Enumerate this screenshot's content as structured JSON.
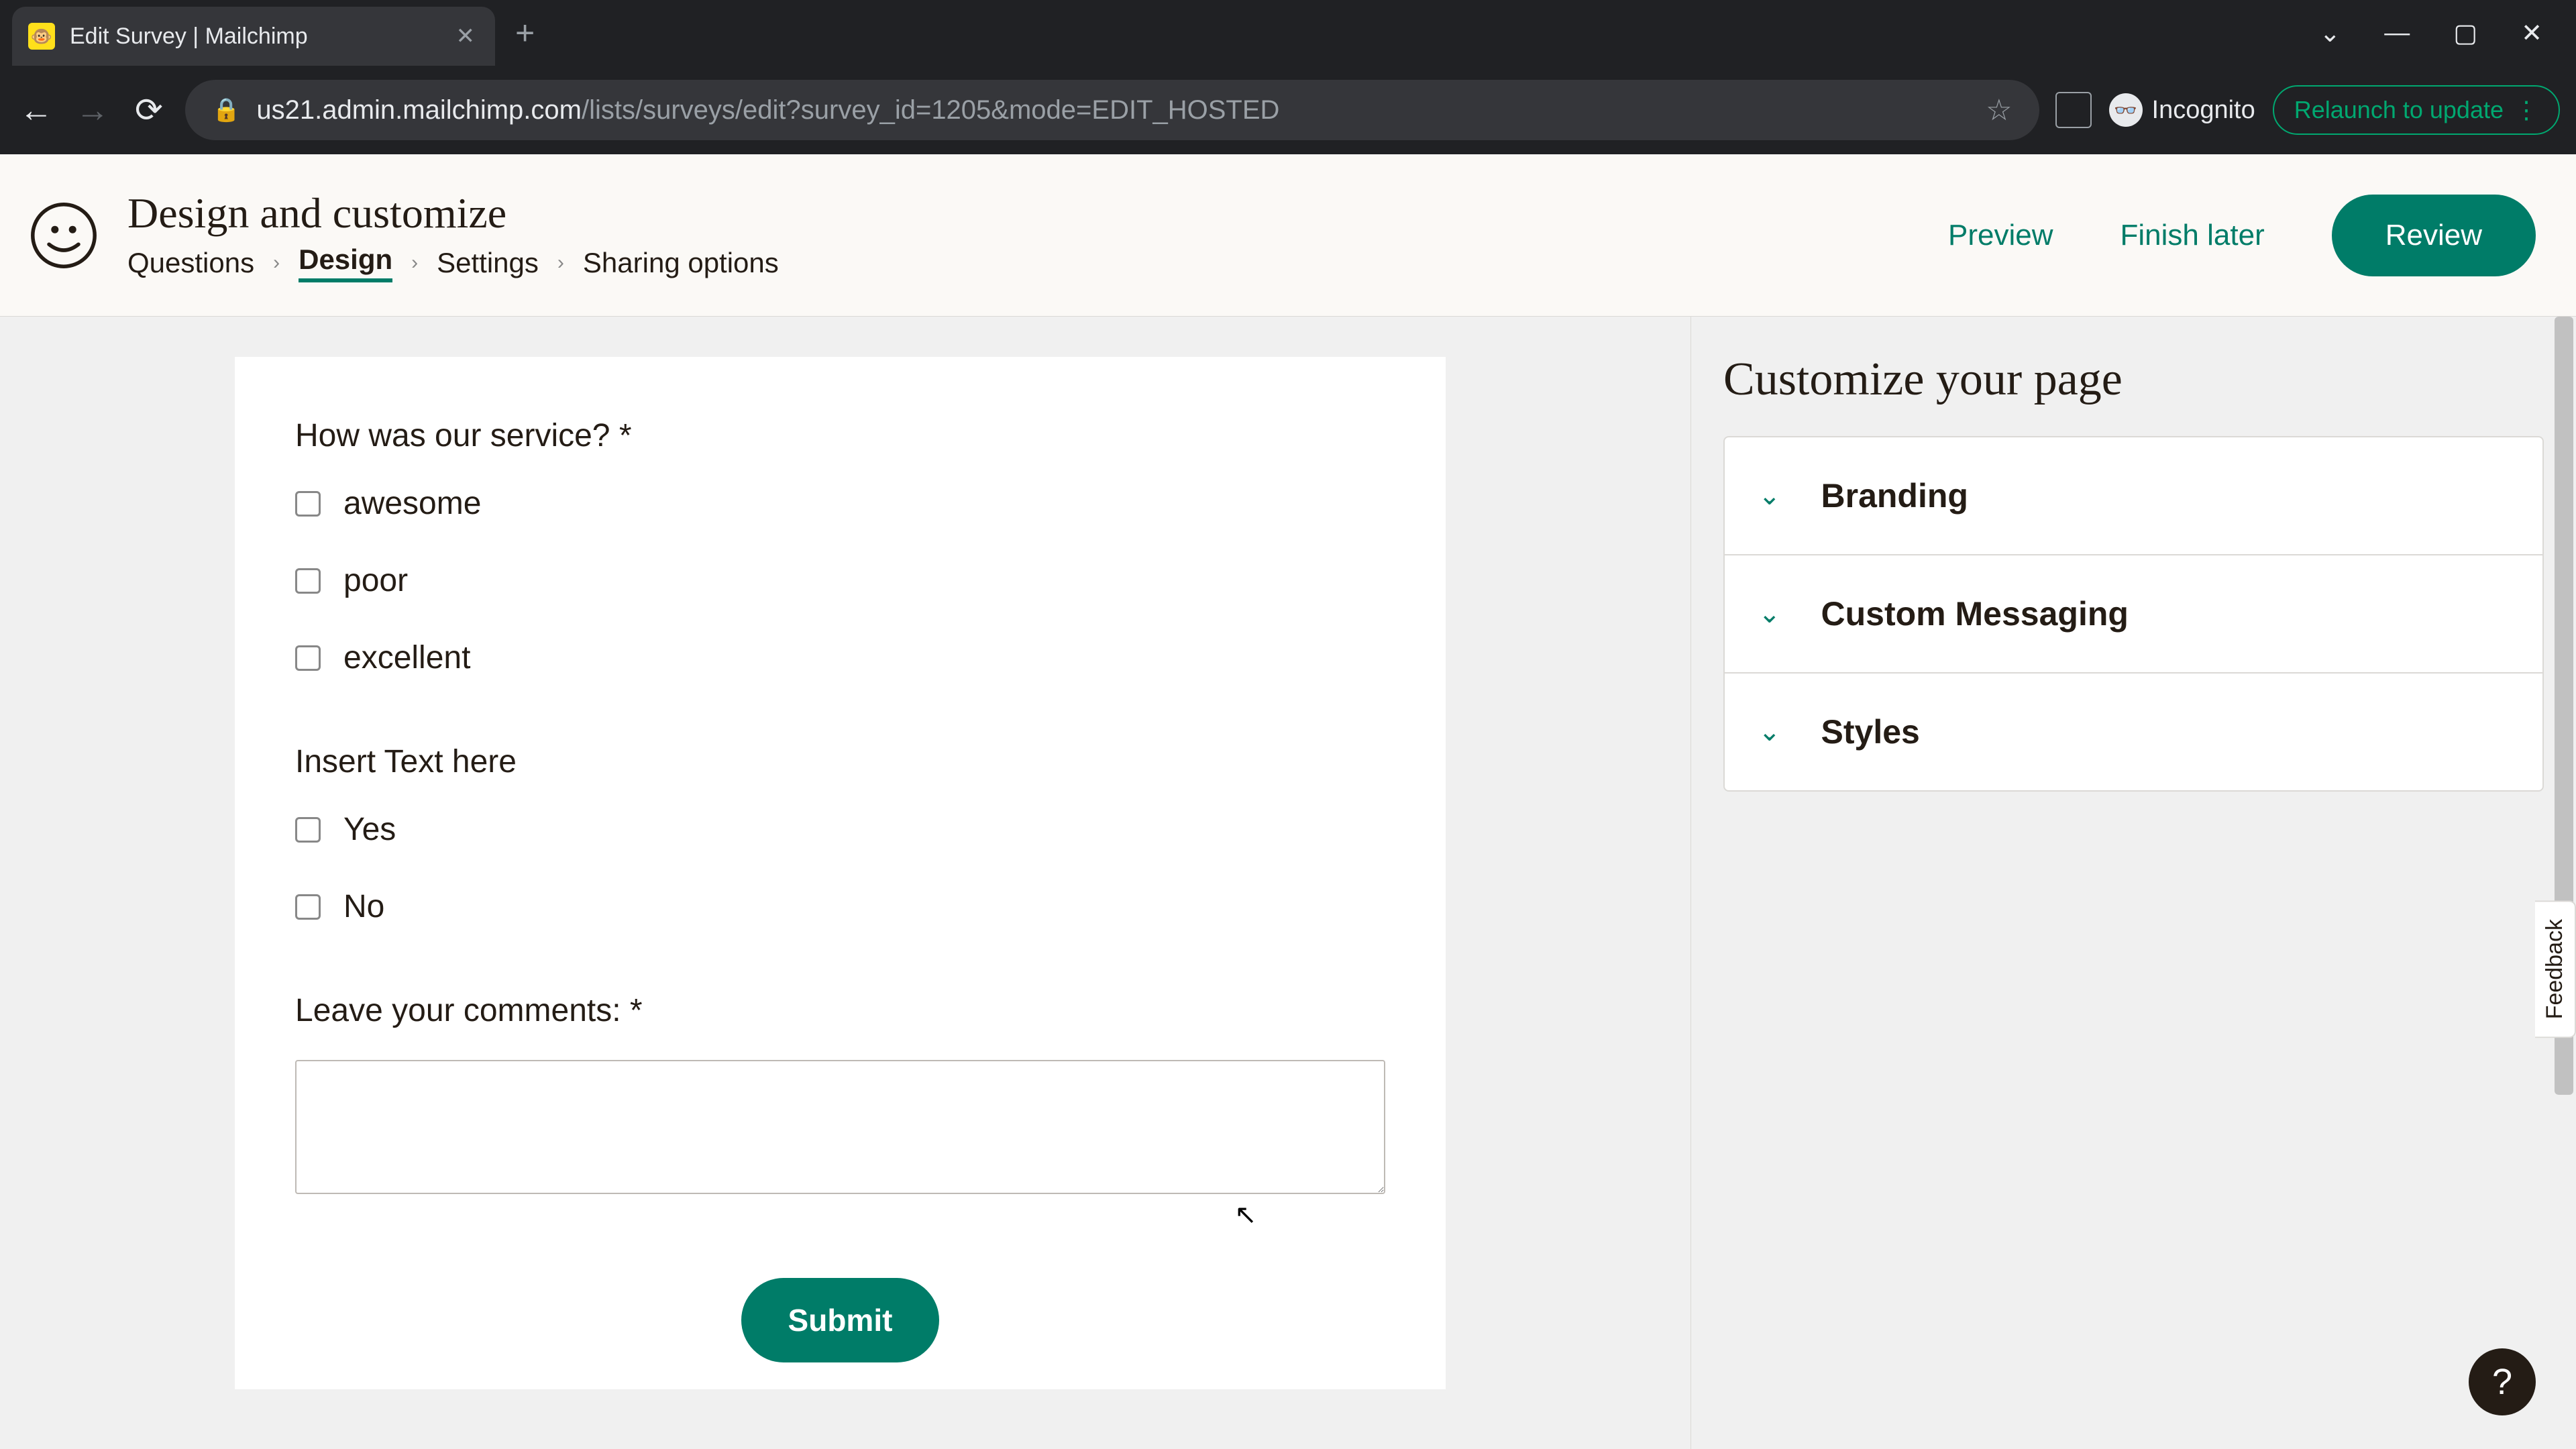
{
  "browser": {
    "tab_title": "Edit Survey | Mailchimp",
    "url_domain": "us21.admin.mailchimp.com",
    "url_path": "/lists/surveys/edit?survey_id=1205&mode=EDIT_HOSTED",
    "incognito_label": "Incognito",
    "relaunch_label": "Relaunch to update"
  },
  "header": {
    "title": "Design and customize",
    "breadcrumbs": [
      "Questions",
      "Design",
      "Settings",
      "Sharing options"
    ],
    "active_breadcrumb": "Design",
    "preview_label": "Preview",
    "finish_later_label": "Finish later",
    "review_label": "Review"
  },
  "survey": {
    "q1": {
      "label": "How was our service? *",
      "options": [
        "awesome",
        "poor",
        "excellent"
      ]
    },
    "q2": {
      "label": "Insert Text here",
      "options": [
        "Yes",
        "No"
      ]
    },
    "q3": {
      "label": "Leave your comments: *"
    },
    "submit_label": "Submit"
  },
  "sidebar": {
    "title": "Customize your page",
    "items": [
      "Branding",
      "Custom Messaging",
      "Styles"
    ]
  },
  "feedback_label": "Feedback",
  "help_label": "?"
}
